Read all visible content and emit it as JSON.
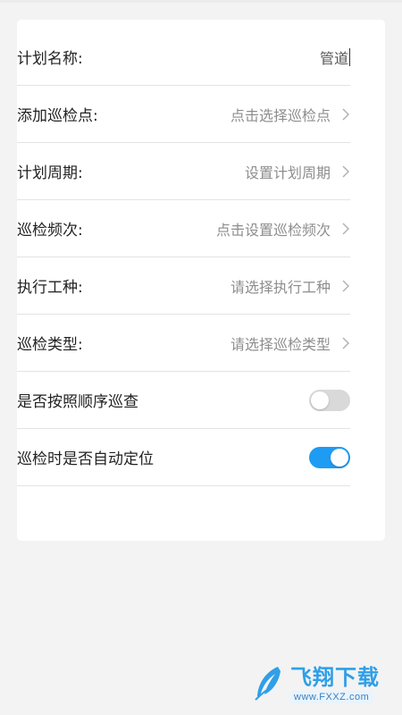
{
  "form": {
    "plan_name": {
      "label": "计划名称:",
      "value": "管道"
    },
    "add_points": {
      "label": "添加巡检点:",
      "value": "点击选择巡检点"
    },
    "plan_period": {
      "label": "计划周期:",
      "value": "设置计划周期"
    },
    "frequency": {
      "label": "巡检频次:",
      "value": "点击设置巡检频次"
    },
    "work_type": {
      "label": "执行工种:",
      "value": "请选择执行工种"
    },
    "inspection_type": {
      "label": "巡检类型:",
      "value": "请选择巡检类型"
    },
    "in_order": {
      "label": "是否按照顺序巡查",
      "checked": false
    },
    "auto_locate": {
      "label": "巡检时是否自动定位",
      "checked": true
    }
  },
  "colors": {
    "toggle_on": "#1e9bf3",
    "toggle_off": "#d9d9d9"
  },
  "watermark": {
    "title": "飞翔下载",
    "url": "www.FXXZ.com"
  }
}
